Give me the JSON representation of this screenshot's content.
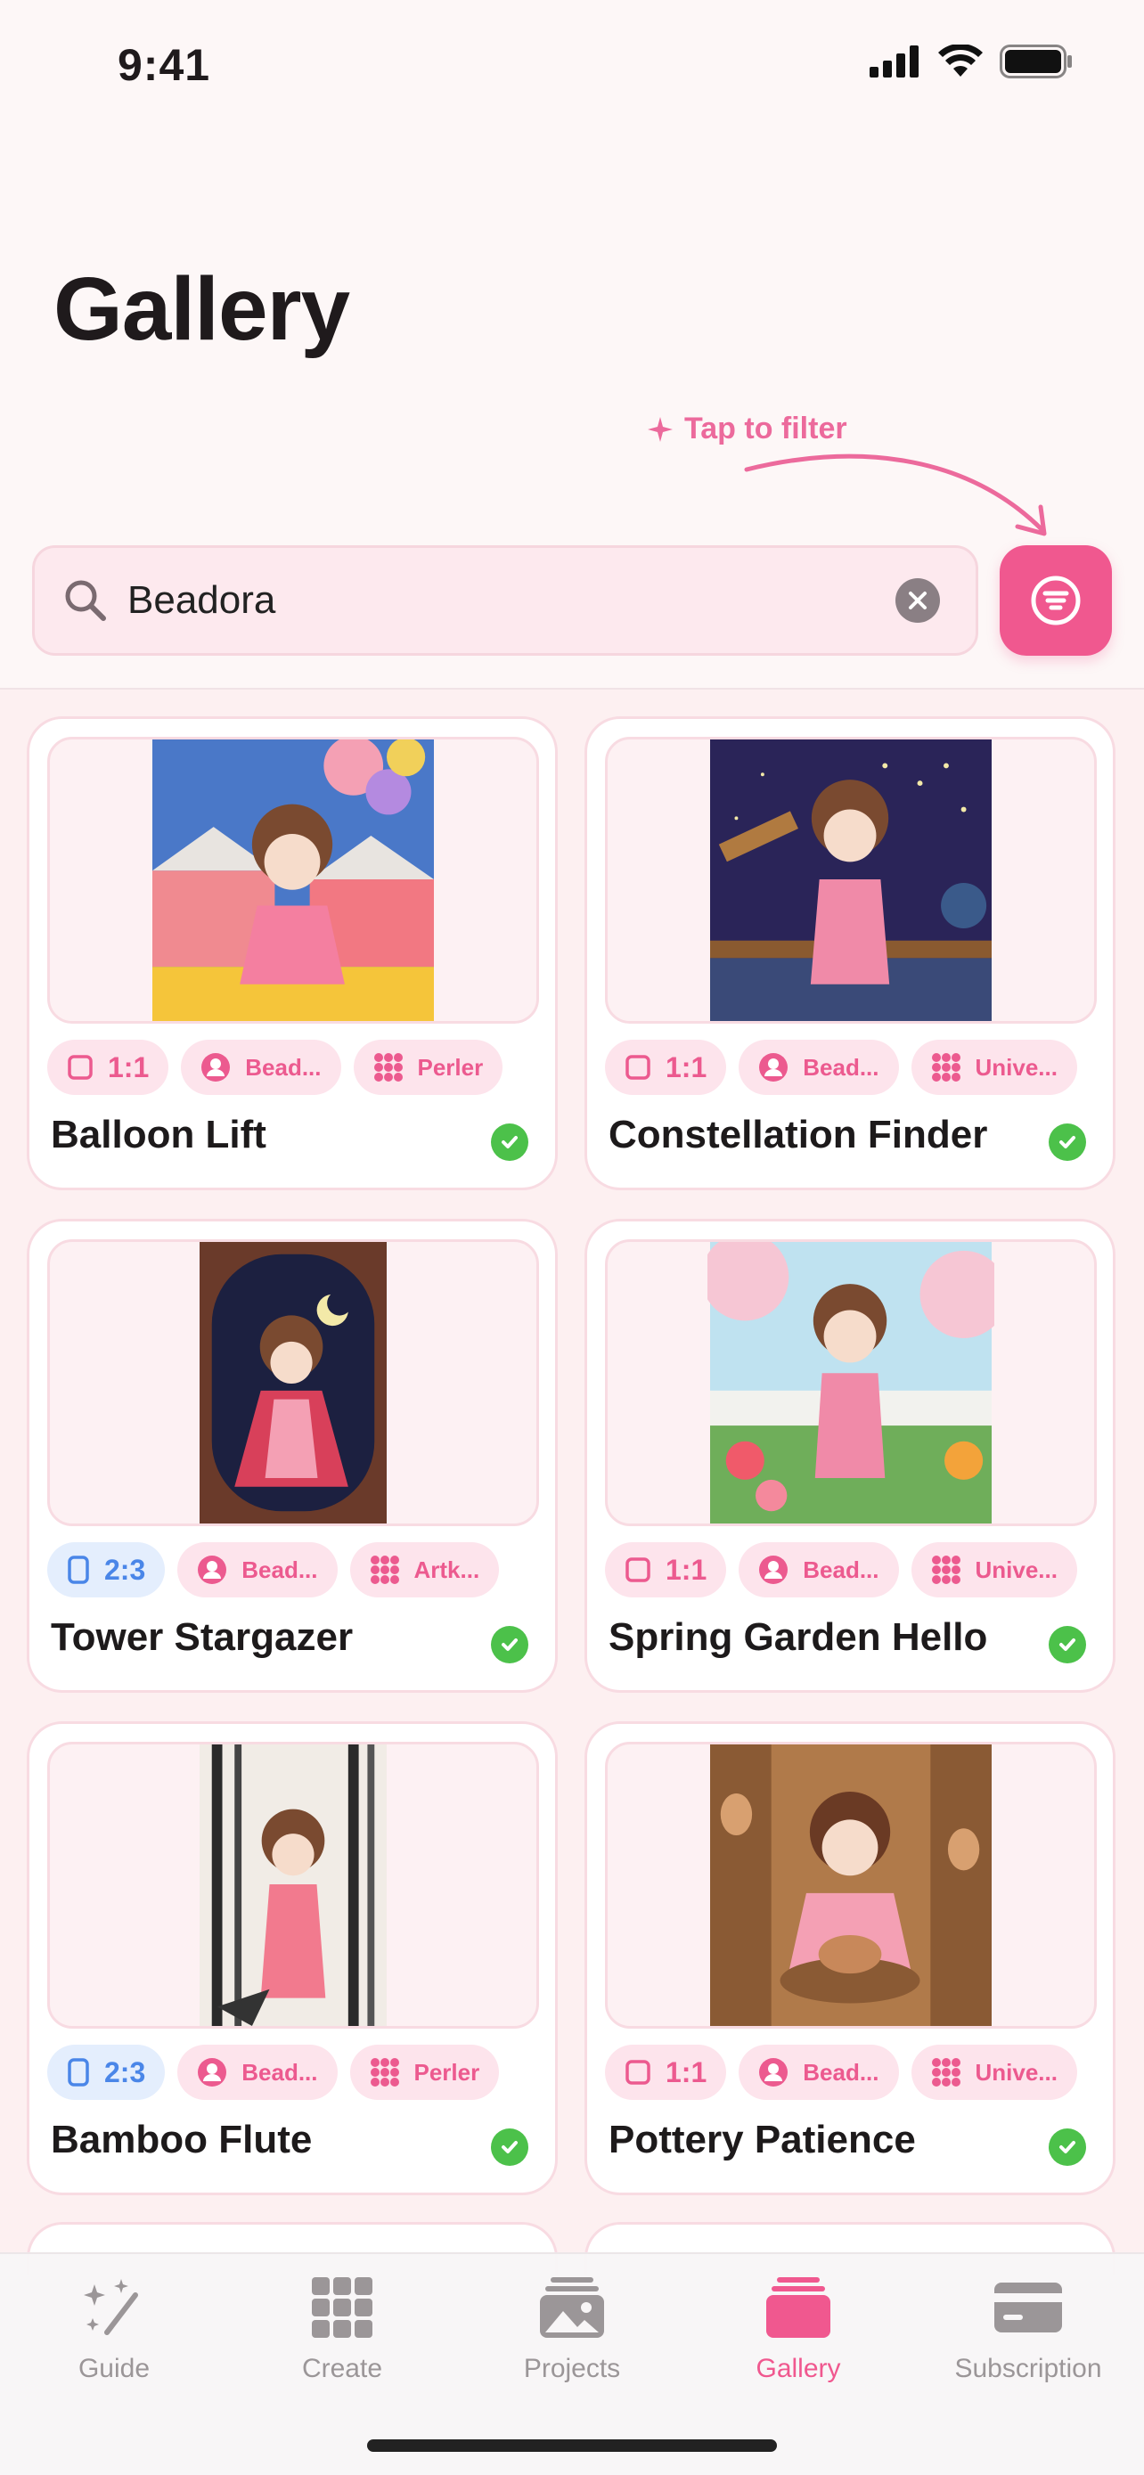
{
  "status": {
    "time": "9:41"
  },
  "page": {
    "title": "Gallery"
  },
  "hint": {
    "text": "Tap to filter"
  },
  "search": {
    "value": "Beadora"
  },
  "icons": {
    "search": "search-icon",
    "clear": "close-circle-icon",
    "filter": "filter-icon",
    "square": "square-icon",
    "portrait": "portrait-rect-icon",
    "person": "person-icon",
    "grid": "grid-dots-icon",
    "check": "check-circle-icon"
  },
  "colors": {
    "accent": "#f0588f",
    "chip_bg": "#fde4ec",
    "blue": "#4a86e8",
    "check": "#4cc14a"
  },
  "cards": [
    {
      "title": "Balloon Lift",
      "ratio": "1:1",
      "creator": "Bead...",
      "brand": "Perler"
    },
    {
      "title": "Constellation Finder",
      "ratio": "1:1",
      "creator": "Bead...",
      "brand": "Unive..."
    },
    {
      "title": "Tower Stargazer",
      "ratio": "2:3",
      "creator": "Bead...",
      "brand": "Artk..."
    },
    {
      "title": "Spring Garden Hello",
      "ratio": "1:1",
      "creator": "Bead...",
      "brand": "Unive..."
    },
    {
      "title": "Bamboo Flute",
      "ratio": "2:3",
      "creator": "Bead...",
      "brand": "Perler"
    },
    {
      "title": "Pottery Patience",
      "ratio": "1:1",
      "creator": "Bead...",
      "brand": "Unive..."
    }
  ],
  "tabs": [
    {
      "label": "Guide",
      "icon": "magic-wand-icon"
    },
    {
      "label": "Create",
      "icon": "grid-icon"
    },
    {
      "label": "Projects",
      "icon": "photo-stack-icon"
    },
    {
      "label": "Gallery",
      "icon": "gallery-stack-icon",
      "active": true
    },
    {
      "label": "Subscription",
      "icon": "credit-card-icon"
    }
  ]
}
